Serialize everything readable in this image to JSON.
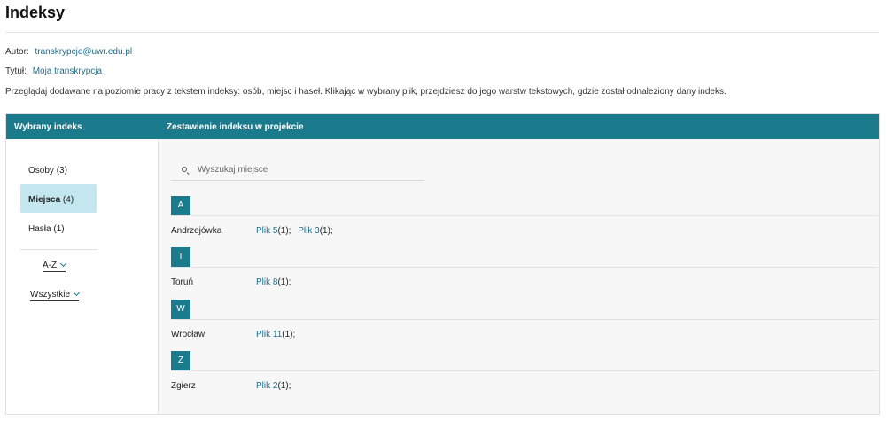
{
  "page": {
    "title": "Indeksy",
    "author_label": "Autor:",
    "author_value": "transkrypcje@uwr.edu.pl",
    "title_label": "Tytuł:",
    "title_value": "Moja transkrypcja",
    "description": "Przeglądaj dodawane na poziomie pracy z tekstem indeksy: osób, miejsc i haseł. Klikając w wybrany plik, przejdziesz do jego warstw tekstowych, gdzie został odnaleziony dany indeks."
  },
  "panel": {
    "left_header": "Wybrany indeks",
    "right_header": "Zestawienie indeksu w projekcie"
  },
  "categories": [
    {
      "label": "Osoby",
      "count": "(3)",
      "active": false
    },
    {
      "label": "Miejsca",
      "count": "(4)",
      "active": true
    },
    {
      "label": "Hasła",
      "count": "(1)",
      "active": false
    }
  ],
  "sort": {
    "selected": "A-Z"
  },
  "filter": {
    "selected": "Wszystkie"
  },
  "search": {
    "placeholder": "Wyszukaj miejsce",
    "value": ""
  },
  "groups": [
    {
      "letter": "A",
      "entries": [
        {
          "name": "Andrzejówka",
          "files": [
            {
              "link": "Plik 5",
              "count": "(1);"
            },
            {
              "link": "Plik 3",
              "count": "(1);"
            }
          ]
        }
      ]
    },
    {
      "letter": "T",
      "entries": [
        {
          "name": "Toruń",
          "files": [
            {
              "link": "Plik 8",
              "count": "(1);"
            }
          ]
        }
      ]
    },
    {
      "letter": "W",
      "entries": [
        {
          "name": "Wrocław",
          "files": [
            {
              "link": "Plik 11",
              "count": "(1);"
            }
          ]
        }
      ]
    },
    {
      "letter": "Z",
      "entries": [
        {
          "name": "Zgierz",
          "files": [
            {
              "link": "Plik 2",
              "count": "(1);"
            }
          ]
        }
      ]
    }
  ],
  "colors": {
    "accent": "#1b7a8c",
    "link": "#1f6e8c",
    "active_bg": "#c4e6ee"
  }
}
